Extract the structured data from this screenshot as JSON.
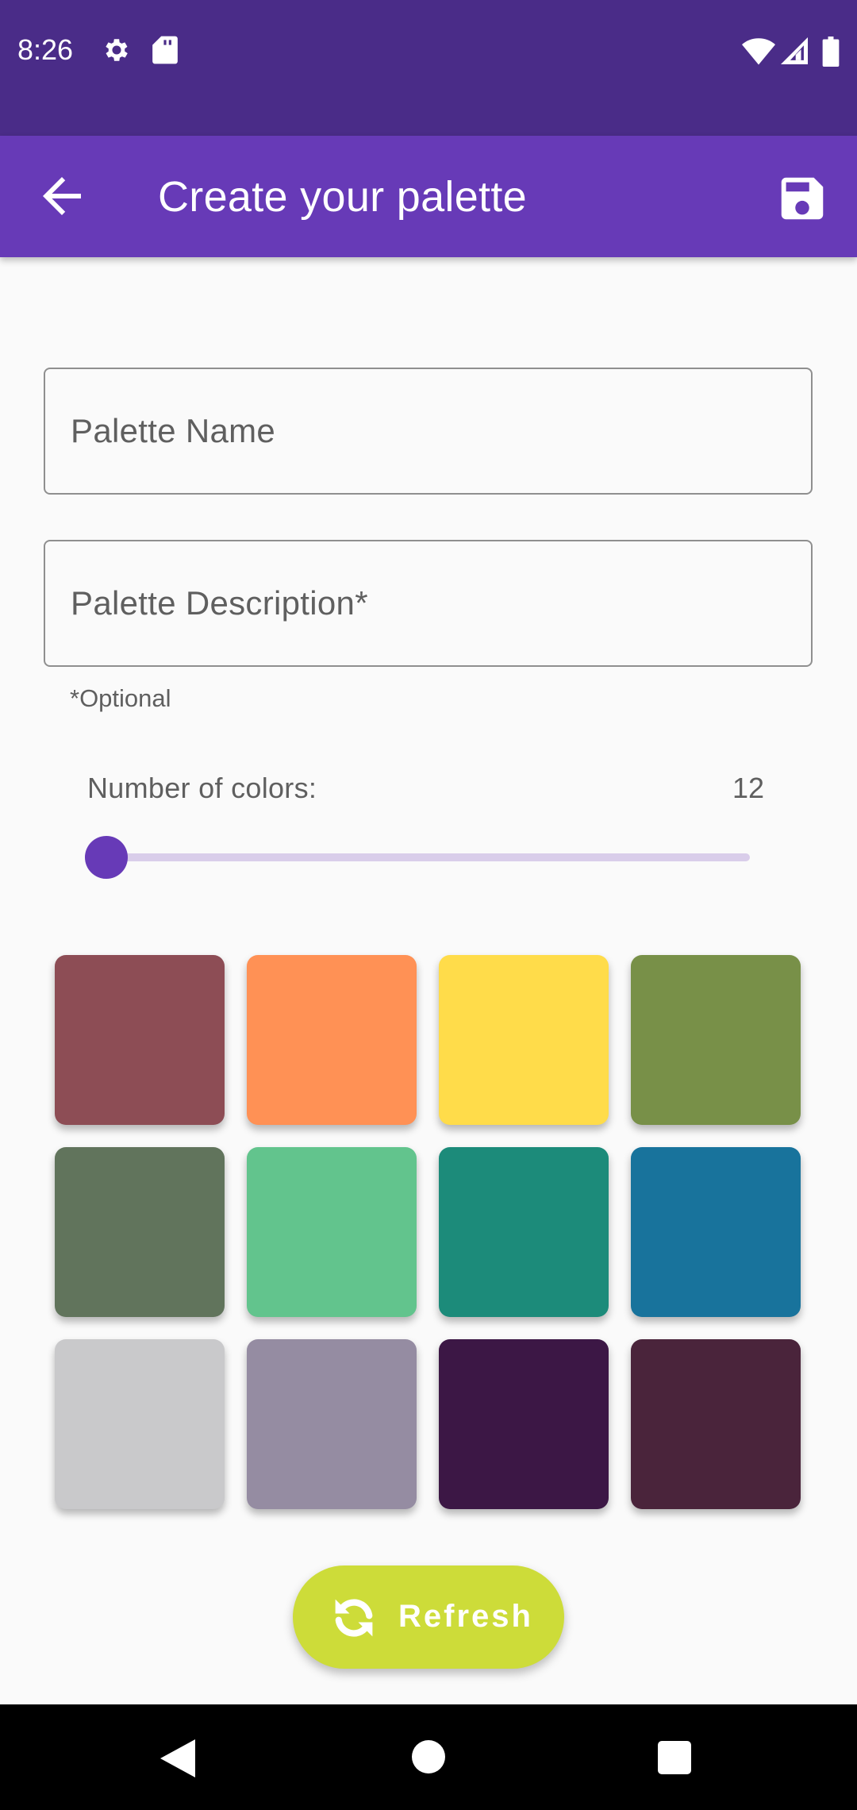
{
  "status_bar": {
    "time": "8:26",
    "left_icons": [
      "settings-icon",
      "sd-card-icon"
    ],
    "right_icons": [
      "wifi-icon",
      "cell-signal-icon",
      "battery-icon"
    ]
  },
  "app_bar": {
    "title": "Create your palette",
    "back_icon": "arrow-back-icon",
    "save_icon": "save-icon"
  },
  "form": {
    "palette_name_placeholder": "Palette Name",
    "palette_description_placeholder": "Palette Description*",
    "helper_text": "*Optional"
  },
  "colors_control": {
    "label": "Number of colors:",
    "value": "12",
    "slider_fraction": 0.0
  },
  "swatches": [
    "#8d4d55",
    "#ff9155",
    "#ffdc4a",
    "#789048",
    "#61745c",
    "#62c48d",
    "#1c8b7a",
    "#18739c",
    "#c9c9cb",
    "#958ca2",
    "#3c1745",
    "#4a243b"
  ],
  "refresh_button": {
    "label": "Refresh",
    "icon": "refresh-icon"
  },
  "colors": {
    "status_bar": "#4a2c88",
    "app_bar": "#673ab7",
    "accent": "#673ab7",
    "refresh": "#cddc39"
  }
}
